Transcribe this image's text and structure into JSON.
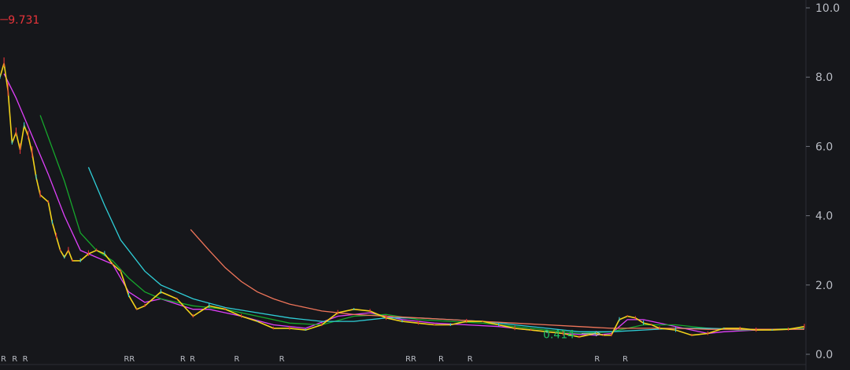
{
  "chart_data": {
    "type": "line",
    "title": "",
    "xlabel": "",
    "ylabel": "",
    "ylim": [
      0,
      10
    ],
    "yticks": [
      "10.0",
      "8.0",
      "6.0",
      "4.0",
      "2.0",
      "0.0"
    ],
    "ytick_values": [
      10,
      8,
      6,
      4,
      2,
      0
    ],
    "grid": false,
    "legend": "none",
    "x_domain": [
      0,
      100
    ],
    "price": {
      "x": [
        0,
        0.5,
        1,
        1.5,
        2,
        2.5,
        3,
        3.5,
        4,
        4.5,
        5,
        6,
        6.5,
        7,
        7.5,
        8,
        8.5,
        9,
        10,
        11,
        12,
        13,
        14,
        15,
        16,
        17,
        18,
        20,
        22,
        24,
        26,
        28,
        30,
        32,
        34,
        36,
        38,
        40,
        42,
        44,
        46,
        48,
        50,
        52,
        54,
        56,
        58,
        60,
        62,
        64,
        66,
        68,
        70,
        72,
        74,
        75,
        76,
        77,
        78,
        79,
        80,
        81,
        82,
        84,
        86,
        88,
        90,
        92,
        94,
        96,
        98,
        100
      ],
      "y": [
        8.0,
        8.4,
        7.6,
        6.1,
        6.4,
        5.9,
        6.6,
        6.3,
        5.8,
        5.1,
        4.6,
        4.4,
        3.8,
        3.4,
        3.0,
        2.8,
        3.0,
        2.7,
        2.7,
        2.9,
        3.0,
        2.9,
        2.6,
        2.4,
        1.7,
        1.3,
        1.4,
        1.8,
        1.6,
        1.1,
        1.4,
        1.3,
        1.1,
        0.95,
        0.75,
        0.75,
        0.7,
        0.85,
        1.2,
        1.3,
        1.25,
        1.05,
        0.95,
        0.9,
        0.85,
        0.85,
        0.95,
        0.95,
        0.85,
        0.75,
        0.7,
        0.65,
        0.6,
        0.5,
        0.6,
        0.55,
        0.55,
        1.0,
        1.1,
        1.05,
        0.9,
        0.85,
        0.75,
        0.7,
        0.55,
        0.6,
        0.75,
        0.75,
        0.7,
        0.7,
        0.72,
        0.8
      ]
    },
    "moving_averages": [
      {
        "color": "#e040fb",
        "x": [
          0.5,
          2,
          4,
          6,
          8,
          10,
          12,
          14,
          16,
          18,
          20,
          22,
          24,
          26,
          28,
          30,
          34,
          38,
          42,
          46,
          50,
          54,
          58,
          62,
          66,
          70,
          74,
          76,
          78,
          80,
          82,
          84,
          86,
          88,
          90,
          94,
          98,
          100
        ],
        "y": [
          8.1,
          7.4,
          6.3,
          5.2,
          4.0,
          3.0,
          2.8,
          2.6,
          1.8,
          1.5,
          1.6,
          1.45,
          1.3,
          1.3,
          1.2,
          1.1,
          0.85,
          0.75,
          1.1,
          1.2,
          1.0,
          0.9,
          0.85,
          0.8,
          0.7,
          0.6,
          0.55,
          0.6,
          1.0,
          1.0,
          0.9,
          0.8,
          0.7,
          0.6,
          0.65,
          0.7,
          0.72,
          0.75
        ]
      },
      {
        "color": "#16a82c",
        "x": [
          5,
          8,
          10,
          12,
          14,
          16,
          18,
          20,
          24,
          28,
          32,
          36,
          40,
          44,
          48,
          52,
          56,
          60,
          64,
          68,
          72,
          76,
          80,
          84,
          88,
          92,
          96,
          100
        ],
        "y": [
          6.9,
          5.0,
          3.5,
          3.0,
          2.7,
          2.2,
          1.8,
          1.6,
          1.4,
          1.3,
          1.1,
          0.9,
          0.85,
          1.1,
          1.15,
          1.0,
          0.95,
          0.9,
          0.8,
          0.7,
          0.6,
          0.65,
          0.85,
          0.85,
          0.75,
          0.7,
          0.72,
          0.75
        ]
      },
      {
        "color": "#2fcfd8",
        "x": [
          11,
          13,
          15,
          18,
          20,
          24,
          28,
          32,
          36,
          40,
          44,
          48,
          52,
          56,
          60,
          64,
          68,
          72,
          76,
          80,
          84,
          88,
          92,
          96,
          100
        ],
        "y": [
          5.4,
          4.3,
          3.3,
          2.4,
          2.0,
          1.6,
          1.35,
          1.2,
          1.05,
          0.95,
          0.95,
          1.05,
          1.05,
          1.0,
          0.95,
          0.85,
          0.75,
          0.65,
          0.65,
          0.7,
          0.75,
          0.75,
          0.72,
          0.72,
          0.73
        ]
      },
      {
        "color": "#f0755a",
        "x": [
          23.7,
          26,
          28,
          30,
          32,
          34,
          36,
          38,
          40,
          44,
          48,
          52,
          56,
          60,
          64,
          68,
          72,
          76,
          80,
          84,
          88,
          92,
          96,
          100
        ],
        "y": [
          3.6,
          3.0,
          2.5,
          2.1,
          1.8,
          1.6,
          1.45,
          1.35,
          1.25,
          1.15,
          1.1,
          1.05,
          1.0,
          0.95,
          0.9,
          0.85,
          0.8,
          0.75,
          0.75,
          0.75,
          0.72,
          0.72,
          0.72,
          0.72
        ]
      }
    ],
    "annotations": [
      {
        "text": "9.731",
        "x": 1,
        "y": 9.731,
        "color": "#e8343a"
      },
      {
        "text": "0.414",
        "x": 68,
        "y": 0.414,
        "color": "#1fbf62"
      }
    ],
    "r_markers": [
      {
        "text": "R",
        "x": 0
      },
      {
        "text": "R",
        "x": 1.4
      },
      {
        "text": "R",
        "x": 2.7
      },
      {
        "text": "RR",
        "x": 15.3
      },
      {
        "text": "R",
        "x": 22.3
      },
      {
        "text": "R",
        "x": 23.5
      },
      {
        "text": "R",
        "x": 29
      },
      {
        "text": "R",
        "x": 34.6
      },
      {
        "text": "RR",
        "x": 50.3
      },
      {
        "text": "R",
        "x": 54.4
      },
      {
        "text": "R",
        "x": 58
      },
      {
        "text": "R",
        "x": 73.8
      },
      {
        "text": "R",
        "x": 77.3
      }
    ]
  }
}
